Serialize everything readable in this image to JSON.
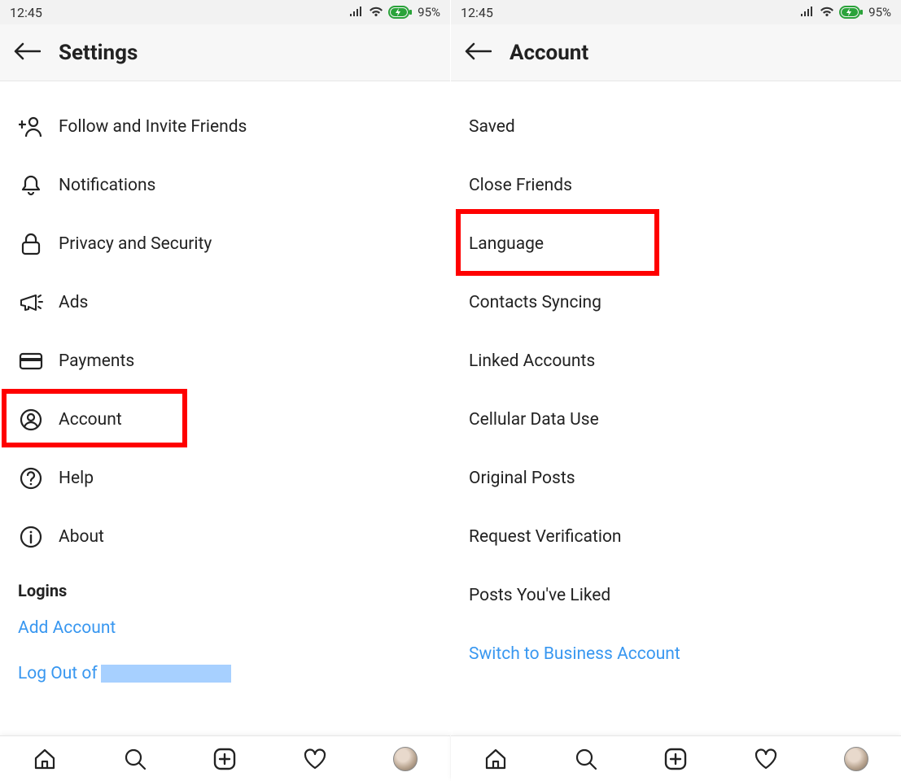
{
  "status": {
    "time": "12:45",
    "battery": "95%"
  },
  "left": {
    "header": "Settings",
    "items": [
      {
        "icon": "add-user-icon",
        "label": "Follow and Invite Friends"
      },
      {
        "icon": "bell-icon",
        "label": "Notifications"
      },
      {
        "icon": "lock-icon",
        "label": "Privacy and Security"
      },
      {
        "icon": "megaphone-icon",
        "label": "Ads"
      },
      {
        "icon": "card-icon",
        "label": "Payments"
      },
      {
        "icon": "user-circle-icon",
        "label": "Account"
      },
      {
        "icon": "help-icon",
        "label": "Help"
      },
      {
        "icon": "info-icon",
        "label": "About"
      }
    ],
    "section": "Logins",
    "add_account": "Add Account",
    "logout_prefix": "Log Out of"
  },
  "right": {
    "header": "Account",
    "items": [
      "Saved",
      "Close Friends",
      "Language",
      "Contacts Syncing",
      "Linked Accounts",
      "Cellular Data Use",
      "Original Posts",
      "Request Verification",
      "Posts You've Liked"
    ],
    "switch": "Switch to Business Account"
  }
}
